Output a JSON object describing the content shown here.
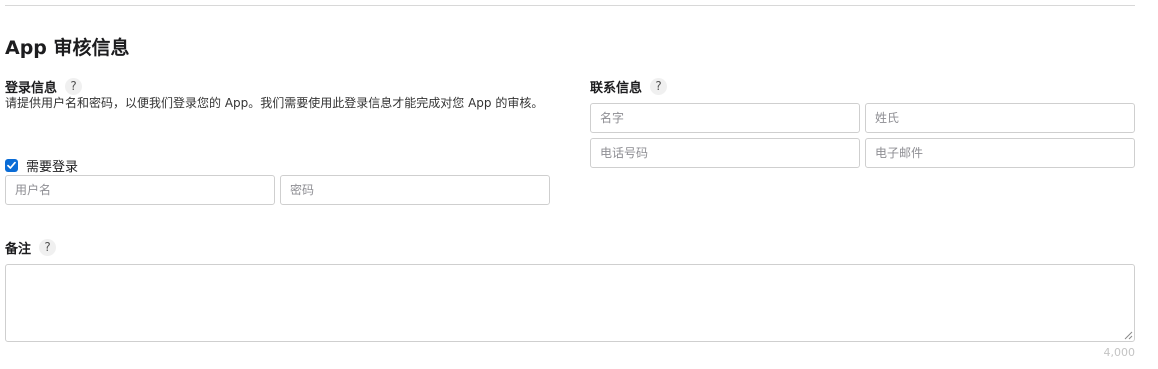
{
  "section": {
    "title": "App 审核信息"
  },
  "login_info": {
    "label": "登录信息",
    "help": "?",
    "description": "请提供用户名和密码，以便我们登录您的 App。我们需要使用此登录信息才能完成对您 App 的审核。",
    "sign_in_required": {
      "label": "需要登录",
      "checked": true
    },
    "username": {
      "placeholder": "用户名",
      "value": ""
    },
    "password": {
      "placeholder": "密码",
      "value": ""
    }
  },
  "contact_info": {
    "label": "联系信息",
    "help": "?",
    "first_name": {
      "placeholder": "名字",
      "value": ""
    },
    "last_name": {
      "placeholder": "姓氏",
      "value": ""
    },
    "phone": {
      "placeholder": "电话号码",
      "value": ""
    },
    "email": {
      "placeholder": "电子邮件",
      "value": ""
    }
  },
  "notes": {
    "label": "备注",
    "help": "?",
    "value": "",
    "char_limit": "4,000"
  },
  "colors": {
    "accent": "#0a6cd6",
    "border": "#cfcfcf",
    "placeholder": "#8e8e93"
  }
}
